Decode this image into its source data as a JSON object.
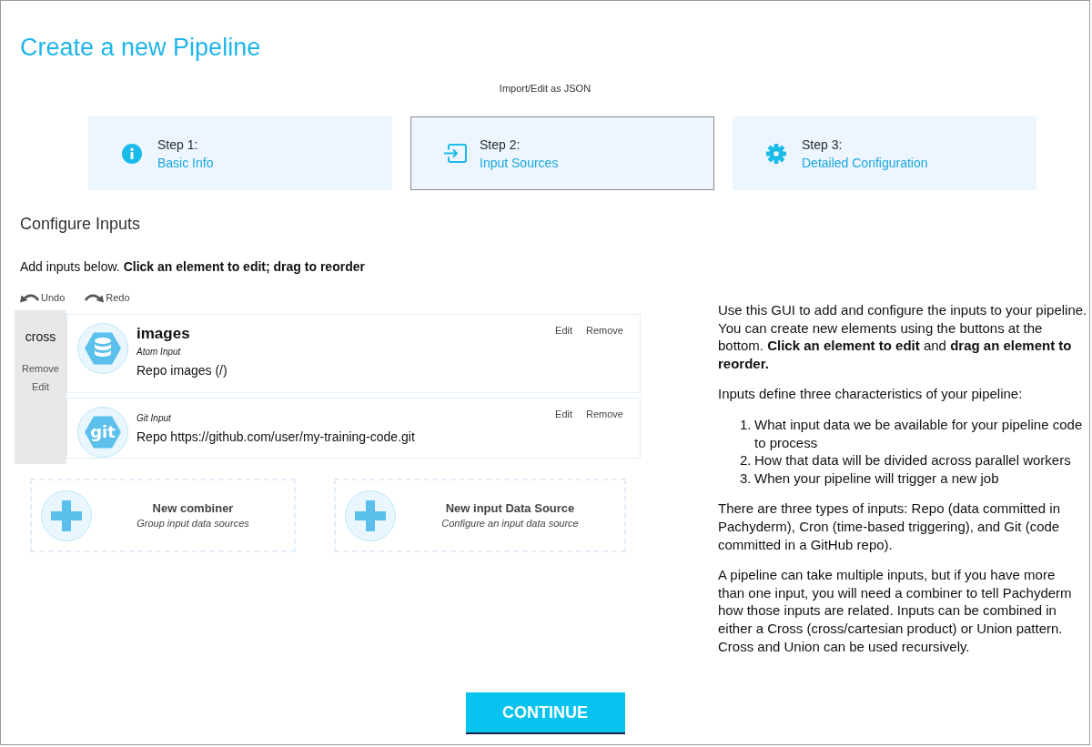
{
  "header": {
    "title": "Create a new Pipeline",
    "import_link": "Import/Edit as JSON"
  },
  "steps": [
    {
      "label": "Step 1:",
      "name": "Basic Info",
      "selected": false
    },
    {
      "label": "Step 2:",
      "name": "Input Sources",
      "selected": true
    },
    {
      "label": "Step 3:",
      "name": "Detailed Configuration",
      "selected": false
    }
  ],
  "section": {
    "heading": "Configure Inputs",
    "instructions": "Add inputs below. **Click an element to edit; drag to reorder**"
  },
  "history": [
    "Undo",
    "Redo"
  ],
  "combiner": {
    "name": "cross",
    "actions": [
      "Remove",
      "Edit"
    ]
  },
  "inputs": [
    {
      "kind": "atom",
      "title": "images",
      "type": "Atom Input",
      "detail": "Repo images (/)",
      "actions": [
        "Edit",
        "Remove"
      ]
    },
    {
      "kind": "git",
      "logo": "git",
      "type": "Git Input",
      "detail": "Repo https://github.com/user/my-training-code.git",
      "actions": [
        "Edit",
        "Remove"
      ]
    }
  ],
  "new_buttons": [
    {
      "title": "New combiner",
      "subtitle": "Group input data sources"
    },
    {
      "title": "New input Data Source",
      "subtitle": "Configure an input data source"
    }
  ],
  "help": [
    {
      "kind": "paragraph",
      "text": "Use this GUI to add and configure the inputs to your pipeline. You can create new elements using the buttons at the bottom. **Click an element to edit** and **drag an element to reorder.**"
    },
    {
      "kind": "paragraph",
      "text": "Inputs define three characteristics of your pipeline:"
    },
    {
      "kind": "list",
      "items": [
        {
          "number": "1.",
          "text": "What input data we be available for your pipeline code to process"
        },
        {
          "number": "2.",
          "text": "How that data will be divided across parallel workers"
        },
        {
          "number": "3.",
          "text": "When your pipeline will trigger a new job"
        }
      ]
    },
    {
      "kind": "paragraph",
      "text": "There are three types of inputs: Repo (data committed in Pachyderm), Cron (time-based triggering), and Git (code committed in a GitHub repo)."
    },
    {
      "kind": "paragraph",
      "text": "A pipeline can take multiple inputs, but if you have more than one input, you will need a combiner to tell Pachyderm how those inputs are related. Inputs can be combined in either a Cross (cross/cartesian product) or Union pattern. Cross and Union can be used recursively."
    }
  ],
  "continue_button": "CONTINUE"
}
